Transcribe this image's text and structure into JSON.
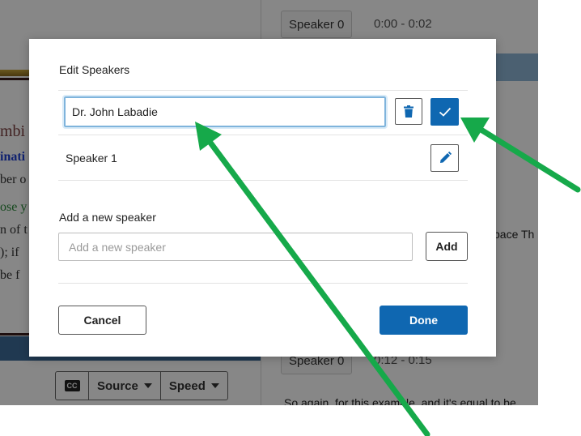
{
  "background": {
    "right_pane": {
      "speaker_chip_top": "Speaker 0",
      "time_top": "0:00 - 0:02",
      "transcript_fragment": "pace Th",
      "speaker_chip_bottom": "Speaker 0",
      "time_bottom": "0:12 - 0:15",
      "transcript_bottom": "So again, for this example, and it's equal to be"
    },
    "left_pane": {
      "doc_fragments": [
        "mbi",
        "inati",
        "ber o",
        "ose y",
        "n of t",
        "); if",
        " be f"
      ],
      "controls": {
        "cc_label": "CC",
        "source_label": "Source",
        "speed_label": "Speed"
      }
    }
  },
  "modal": {
    "title": "Edit Speakers",
    "editing_speaker": {
      "value": "Dr. John Labadie"
    },
    "speakers": [
      {
        "label": "Speaker 1"
      }
    ],
    "add_section": {
      "title": "Add a new speaker",
      "placeholder": "Add a new speaker",
      "add_label": "Add"
    },
    "cancel_label": "Cancel",
    "done_label": "Done"
  },
  "colors": {
    "primary": "#0f67b1",
    "annotation_arrow": "#16a94a",
    "input_focus": "#7fb4dc"
  },
  "icons": [
    "trash-icon",
    "check-icon",
    "pencil-icon",
    "closed-captions-icon",
    "caret-down-icon"
  ]
}
